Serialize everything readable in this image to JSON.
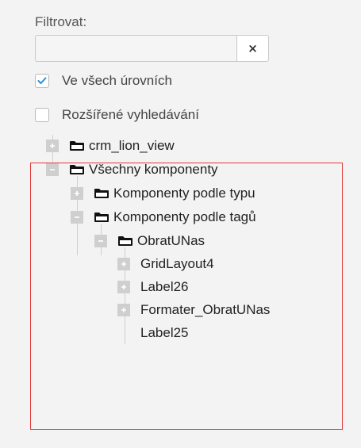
{
  "filter": {
    "label": "Filtrovat:",
    "input_value": "",
    "input_placeholder": "",
    "clear_label": "×"
  },
  "options": {
    "all_levels": {
      "label": "Ve všech úrovních",
      "checked": true
    },
    "advanced_search": {
      "label": "Rozšířené vyhledávání",
      "checked": false
    }
  },
  "tree": {
    "nodes": [
      {
        "label": "crm_lion_view",
        "toggle": "collapsed",
        "folder": true
      },
      {
        "label": "Všechny komponenty",
        "toggle": "expanded",
        "folder": true
      },
      {
        "label": "Komponenty podle typu",
        "toggle": "collapsed",
        "folder": true
      },
      {
        "label": "Komponenty podle tagů",
        "toggle": "expanded",
        "folder": true
      },
      {
        "label": "ObratUNas",
        "toggle": "expanded",
        "folder": true
      },
      {
        "label": "GridLayout4",
        "toggle": "collapsed",
        "folder": false
      },
      {
        "label": "Label26",
        "toggle": "collapsed",
        "folder": false
      },
      {
        "label": "Formater_ObratUNas",
        "toggle": "collapsed",
        "folder": false
      },
      {
        "label": "Label25",
        "toggle": "none",
        "folder": false
      }
    ]
  },
  "colors": {
    "background": "#f3f3f3",
    "toggle": "#cfcfcf",
    "check": "#2a8fd6",
    "highlight": "#e23a3a"
  }
}
